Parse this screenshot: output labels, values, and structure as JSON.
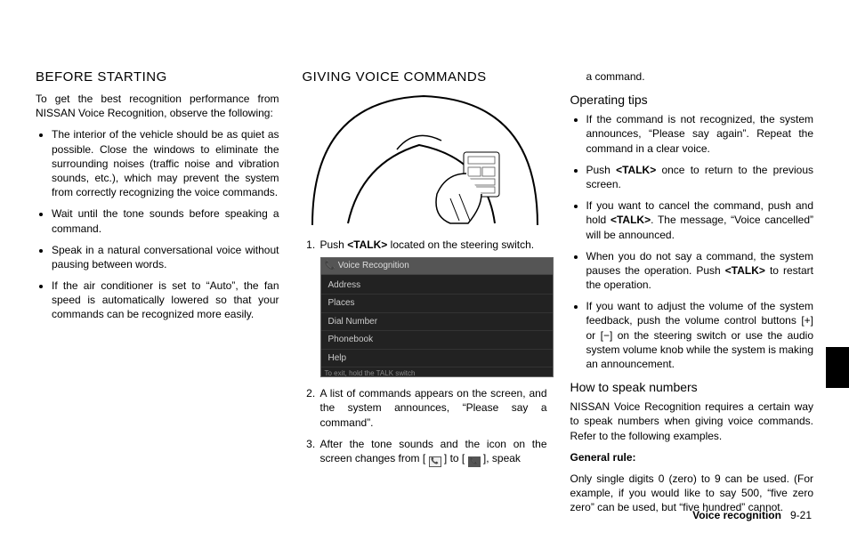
{
  "col1": {
    "heading": "BEFORE STARTING",
    "intro": "To get the best recognition performance from NISSAN Voice Recognition, observe the following:",
    "bullets": [
      "The interior of the vehicle should be as quiet as possible. Close the windows to eliminate the surrounding noises (traffic noise and vibration sounds, etc.), which may prevent the system from correctly recognizing the voice commands.",
      "Wait until the tone sounds before speaking a command.",
      "Speak in a natural conversational voice without pausing between words.",
      "If the air conditioner is set to “Auto”, the fan speed is automatically lowered so that your commands can be recognized more easily."
    ]
  },
  "col2": {
    "heading": "GIVING VOICE COMMANDS",
    "step1_pre": "Push ",
    "step1_cmd": "<TALK>",
    "step1_post": " located on the steering switch.",
    "screenshot": {
      "title": "Voice Recognition",
      "items": [
        "Address",
        "Places",
        "Dial Number",
        "Phonebook",
        "Help"
      ],
      "foot": "To exit, hold the TALK switch"
    },
    "step2": "A list of commands appears on the screen, and the system announces, “Please say a command”.",
    "step3_pre": "After the tone sounds and the icon on the screen changes from [ ",
    "step3_mid": " ] to [ ",
    "step3_post": " ], speak"
  },
  "col3": {
    "cont": "a command.",
    "h3a": "Operating tips",
    "tips": [
      "If the command is not recognized, the system announces, “Please say again”. Repeat the command in a clear voice.",
      "",
      "",
      "",
      "If you want to adjust the volume of the system feedback, push the volume control buttons [+] or [−] on the steering switch or use the audio system volume knob while the system is making an announcement."
    ],
    "tip2_pre": "Push ",
    "tip2_cmd": "<TALK>",
    "tip2_post": " once to return to the previous screen.",
    "tip3_pre": "If you want to cancel the command, push and hold ",
    "tip3_cmd": "<TALK>",
    "tip3_post": ". The message, “Voice cancelled” will be announced.",
    "tip4_pre": "When you do not say a command, the system pauses the operation. Push ",
    "tip4_cmd": "<TALK>",
    "tip4_post": " to restart the operation.",
    "h3b": "How to speak numbers",
    "p2": "NISSAN Voice Recognition requires a certain way to speak numbers when giving voice commands. Refer to the following examples.",
    "rule_label": "General rule:",
    "rule_body": "Only single digits 0 (zero) to 9 can be used. (For example, if you would like to say 500, “five zero zero” can be used, but “five hundred” cannot."
  },
  "footer": {
    "section": "Voice recognition",
    "page": "9-21"
  }
}
